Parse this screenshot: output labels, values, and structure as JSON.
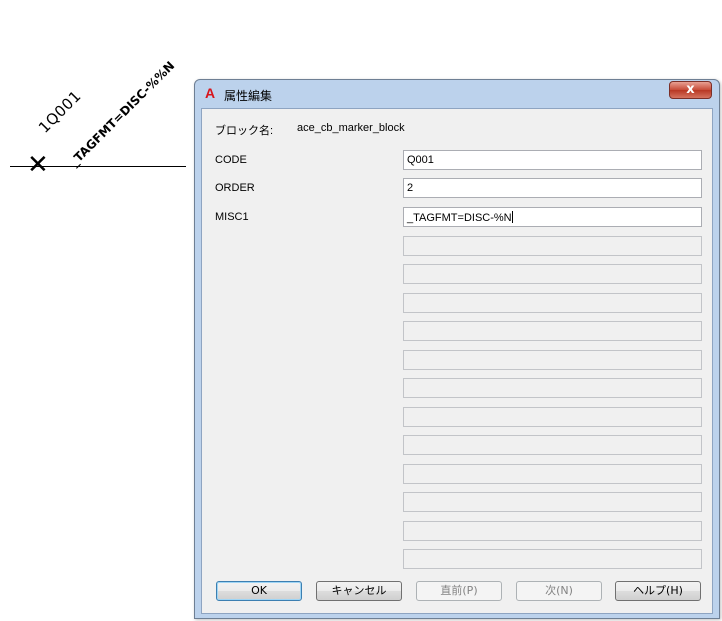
{
  "canvas": {
    "attribute_text_1": "1Q001",
    "attribute_text_2": "_TAGFMT=DISC-%%N",
    "marker_glyph": "✕"
  },
  "dialog": {
    "title": "属性編集",
    "app_icon": "autocad-a-icon",
    "close_glyph": "x",
    "block_name_label": "ブロック名:",
    "block_name_value": "ace_cb_marker_block",
    "attributes": [
      {
        "tag": "CODE",
        "value": "Q001"
      },
      {
        "tag": "ORDER",
        "value": "2"
      },
      {
        "tag": "MISC1",
        "value": "_TAGFMT=DISC-%N"
      }
    ],
    "empty_field_count": 12,
    "buttons": {
      "ok": "OK",
      "cancel": "キャンセル",
      "previous": "直前(P)",
      "next": "次(N)",
      "help": "ヘルプ(H)"
    }
  },
  "colors": {
    "frame": "#bcd2ec",
    "client": "#f0f0f0",
    "close_button": "#c74a37",
    "app_icon": "#d8141b"
  }
}
